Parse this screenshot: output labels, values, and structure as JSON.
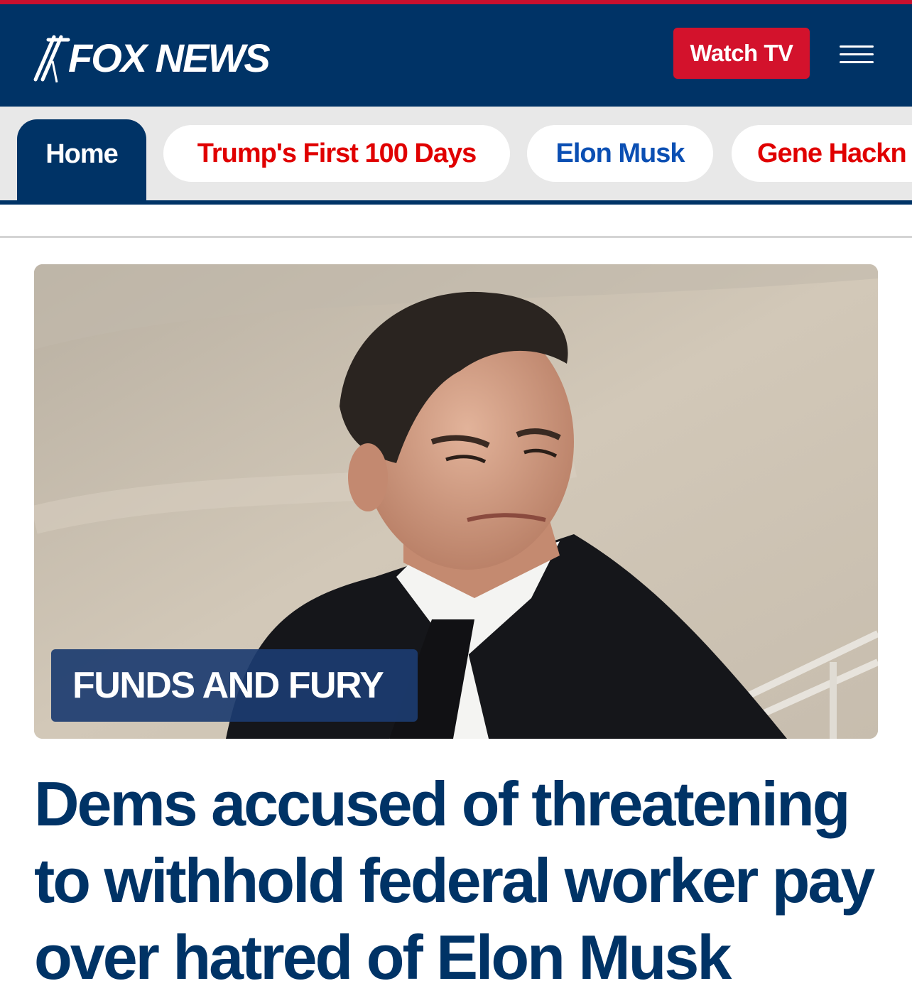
{
  "header": {
    "logo_text": "FOX NEWS",
    "watch_tv_label": "Watch TV",
    "colors": {
      "brand_navy": "#003366",
      "accent_red": "#d3122c"
    }
  },
  "nav": {
    "tabs": [
      {
        "label": "Home",
        "active": true
      },
      {
        "label": "Trump's First 100 Days"
      },
      {
        "label": "Elon Musk"
      },
      {
        "label": "Gene Hackn"
      }
    ]
  },
  "story": {
    "kicker": "FUNDS AND FURY",
    "headline": "Dems accused of threatening to withhold federal worker pay over hatred of Elon Musk"
  },
  "icons": {
    "menu": "hamburger-menu-icon",
    "logo": "fox-news-logo-icon"
  }
}
